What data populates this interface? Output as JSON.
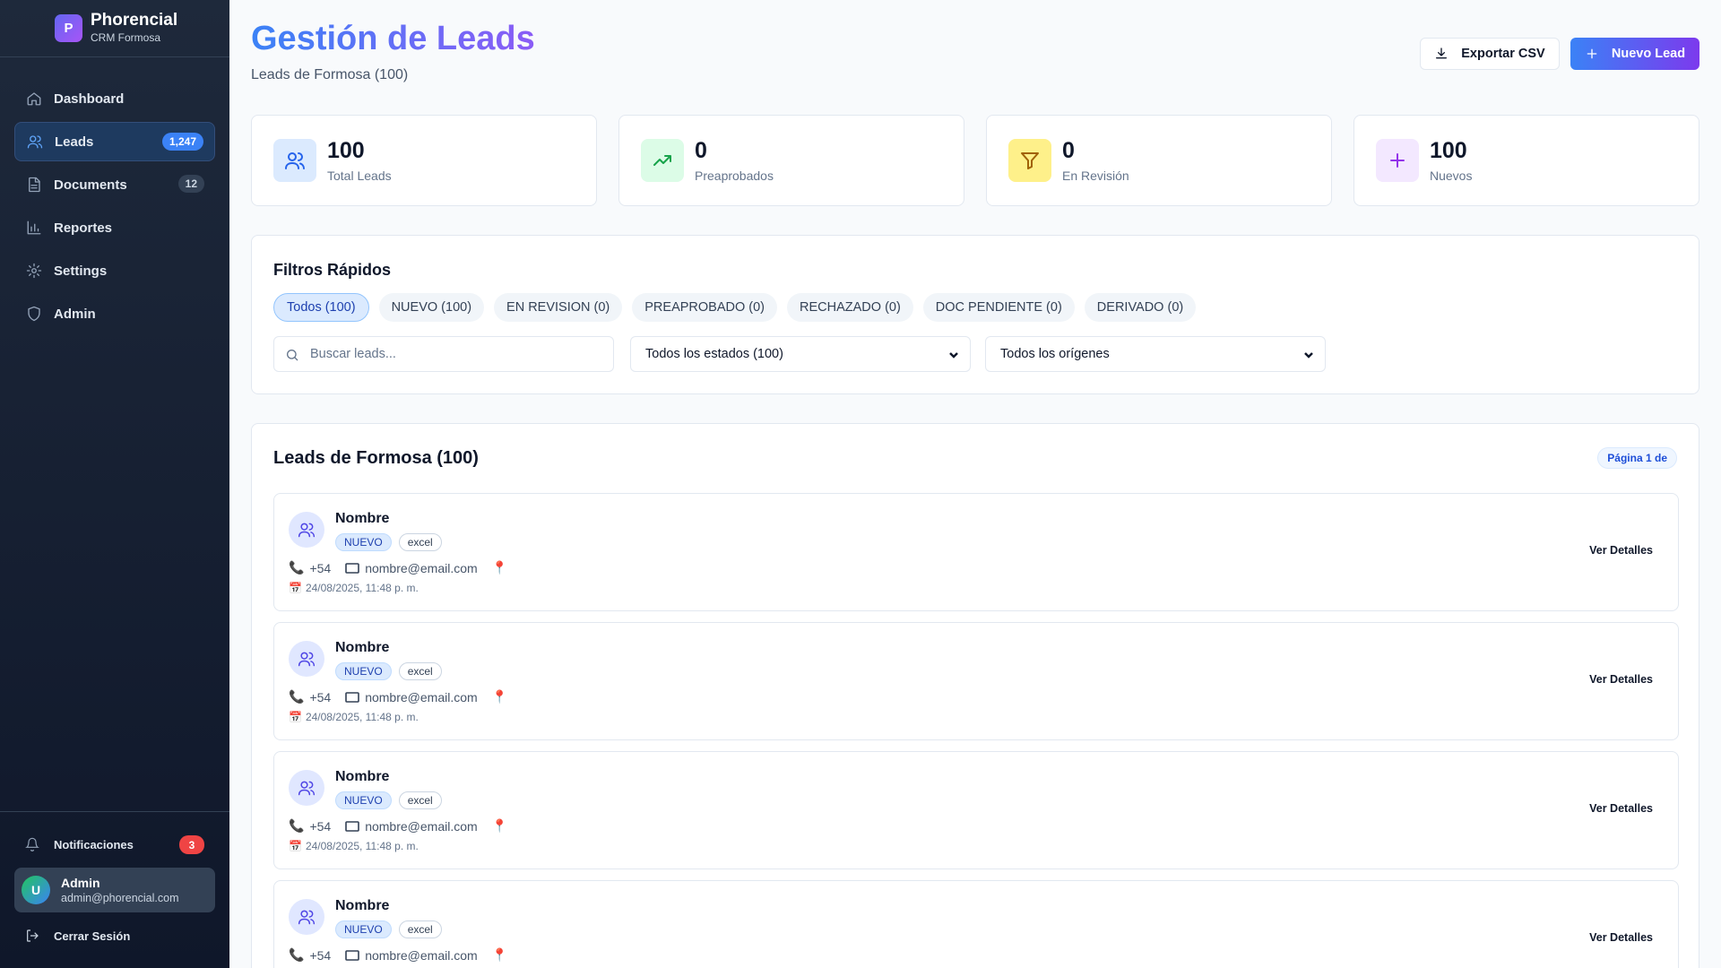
{
  "brand": {
    "initial": "P",
    "name": "Phorencial",
    "subtitle": "CRM Formosa"
  },
  "nav": [
    {
      "label": "Dashboard",
      "icon": "home-icon",
      "badge": null,
      "active": false
    },
    {
      "label": "Leads",
      "icon": "users-icon",
      "badge": "1,247",
      "active": true
    },
    {
      "label": "Documents",
      "icon": "document-icon",
      "badge": "12",
      "active": false
    },
    {
      "label": "Reportes",
      "icon": "bar-chart-icon",
      "badge": null,
      "active": false
    },
    {
      "label": "Settings",
      "icon": "gear-icon",
      "badge": null,
      "active": false
    },
    {
      "label": "Admin",
      "icon": "shield-icon",
      "badge": null,
      "active": false
    }
  ],
  "notifications": {
    "label": "Notificaciones",
    "count": "3"
  },
  "user": {
    "initial": "U",
    "name": "Admin",
    "email": "admin@phorencial.com"
  },
  "logout_label": "Cerrar Sesión",
  "header": {
    "title": "Gestión de Leads",
    "subtitle": "Leads de Formosa (100)",
    "export_label": "Exportar CSV",
    "new_label": "Nuevo Lead"
  },
  "stats": [
    {
      "value": "100",
      "label": "Total Leads",
      "icon": "users-icon",
      "color": "#dbeafe",
      "stroke": "#2563eb"
    },
    {
      "value": "0",
      "label": "Preaprobados",
      "icon": "trending-up-icon",
      "color": "#dcfce7",
      "stroke": "#16a34a"
    },
    {
      "value": "0",
      "label": "En Revisión",
      "icon": "filter-icon",
      "color": "#fef9c3",
      "stroke": "#ca8a04"
    },
    {
      "value": "100",
      "label": "Nuevos",
      "icon": "plus-icon",
      "color": "#f3e8ff",
      "stroke": "#9333ea"
    }
  ],
  "filters": {
    "title": "Filtros Rápidos",
    "chips": [
      "Todos (100)",
      "NUEVO (100)",
      "EN REVISION (0)",
      "PREAPROBADO (0)",
      "RECHAZADO (0)",
      "DOC PENDIENTE (0)",
      "DERIVADO (0)"
    ],
    "search_placeholder": "Buscar leads...",
    "status_select": "Todos los estados (100)",
    "origin_select": "Todos los orígenes"
  },
  "list": {
    "title": "Leads de Formosa (100)",
    "page_badge": "Página 1 de",
    "action_label": "Ver Detalles",
    "leads": [
      {
        "name": "Nombre",
        "status": "NUEVO",
        "source": "excel",
        "phone": "+54",
        "email": "nombre@email.com",
        "date": "24/08/2025, 11:48 p. m."
      },
      {
        "name": "Nombre",
        "status": "NUEVO",
        "source": "excel",
        "phone": "+54",
        "email": "nombre@email.com",
        "date": "24/08/2025, 11:48 p. m."
      },
      {
        "name": "Nombre",
        "status": "NUEVO",
        "source": "excel",
        "phone": "+54",
        "email": "nombre@email.com",
        "date": "24/08/2025, 11:48 p. m."
      },
      {
        "name": "Nombre",
        "status": "NUEVO",
        "source": "excel",
        "phone": "+54",
        "email": "nombre@email.com",
        "date": ""
      }
    ]
  }
}
